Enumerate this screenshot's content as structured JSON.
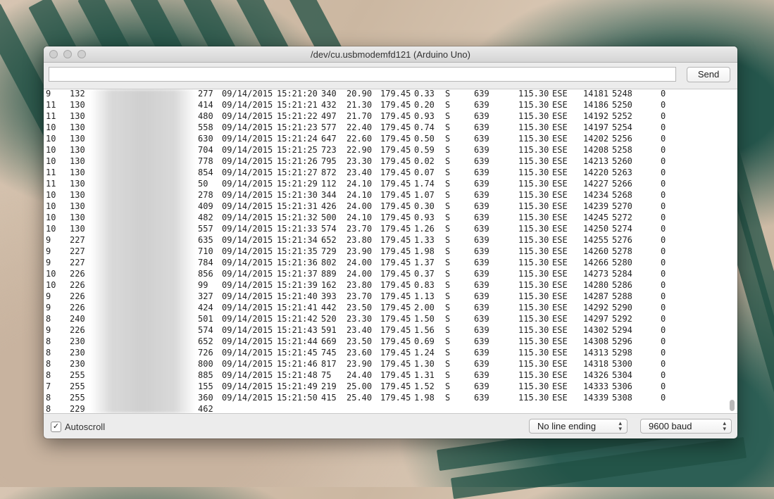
{
  "window": {
    "title": "/dev/cu.usbmodemfd121 (Arduino Uno)"
  },
  "toolbar": {
    "input_value": "",
    "send_label": "Send"
  },
  "console": {
    "lines": [
      {
        "c0": "9",
        "c1": "132",
        "c2": "277",
        "date": "09/14/2015",
        "time": "15:21:20",
        "c3": "340",
        "c4": "20.90",
        "c5": "179.45",
        "c6": "0.33",
        "c7": "S",
        "c8": "639",
        "c9": "115.30",
        "c10": "ESE",
        "c11": "14181",
        "c12": "5248",
        "c13": "0"
      },
      {
        "c0": "11",
        "c1": "130",
        "c2": "414",
        "date": "09/14/2015",
        "time": "15:21:21",
        "c3": "432",
        "c4": "21.30",
        "c5": "179.45",
        "c6": "0.20",
        "c7": "S",
        "c8": "639",
        "c9": "115.30",
        "c10": "ESE",
        "c11": "14186",
        "c12": "5250",
        "c13": "0"
      },
      {
        "c0": "11",
        "c1": "130",
        "c2": "480",
        "date": "09/14/2015",
        "time": "15:21:22",
        "c3": "497",
        "c4": "21.70",
        "c5": "179.45",
        "c6": "0.93",
        "c7": "S",
        "c8": "639",
        "c9": "115.30",
        "c10": "ESE",
        "c11": "14192",
        "c12": "5252",
        "c13": "0"
      },
      {
        "c0": "10",
        "c1": "130",
        "c2": "558",
        "date": "09/14/2015",
        "time": "15:21:23",
        "c3": "577",
        "c4": "22.40",
        "c5": "179.45",
        "c6": "0.74",
        "c7": "S",
        "c8": "639",
        "c9": "115.30",
        "c10": "ESE",
        "c11": "14197",
        "c12": "5254",
        "c13": "0"
      },
      {
        "c0": "10",
        "c1": "130",
        "c2": "630",
        "date": "09/14/2015",
        "time": "15:21:24",
        "c3": "647",
        "c4": "22.60",
        "c5": "179.45",
        "c6": "0.50",
        "c7": "S",
        "c8": "639",
        "c9": "115.30",
        "c10": "ESE",
        "c11": "14202",
        "c12": "5256",
        "c13": "0"
      },
      {
        "c0": "10",
        "c1": "130",
        "c2": "704",
        "date": "09/14/2015",
        "time": "15:21:25",
        "c3": "723",
        "c4": "22.90",
        "c5": "179.45",
        "c6": "0.59",
        "c7": "S",
        "c8": "639",
        "c9": "115.30",
        "c10": "ESE",
        "c11": "14208",
        "c12": "5258",
        "c13": "0"
      },
      {
        "c0": "10",
        "c1": "130",
        "c2": "778",
        "date": "09/14/2015",
        "time": "15:21:26",
        "c3": "795",
        "c4": "23.30",
        "c5": "179.45",
        "c6": "0.02",
        "c7": "S",
        "c8": "639",
        "c9": "115.30",
        "c10": "ESE",
        "c11": "14213",
        "c12": "5260",
        "c13": "0"
      },
      {
        "c0": "11",
        "c1": "130",
        "c2": "854",
        "date": "09/14/2015",
        "time": "15:21:27",
        "c3": "872",
        "c4": "23.40",
        "c5": "179.45",
        "c6": "0.07",
        "c7": "S",
        "c8": "639",
        "c9": "115.30",
        "c10": "ESE",
        "c11": "14220",
        "c12": "5263",
        "c13": "0"
      },
      {
        "c0": "11",
        "c1": "130",
        "c2": "50",
        "date": "09/14/2015",
        "time": "15:21:29",
        "c3": "112",
        "c4": "24.10",
        "c5": "179.45",
        "c6": "1.74",
        "c7": "S",
        "c8": "639",
        "c9": "115.30",
        "c10": "ESE",
        "c11": "14227",
        "c12": "5266",
        "c13": "0"
      },
      {
        "c0": "10",
        "c1": "130",
        "c2": "278",
        "date": "09/14/2015",
        "time": "15:21:30",
        "c3": "344",
        "c4": "24.10",
        "c5": "179.45",
        "c6": "1.07",
        "c7": "S",
        "c8": "639",
        "c9": "115.30",
        "c10": "ESE",
        "c11": "14234",
        "c12": "5268",
        "c13": "0"
      },
      {
        "c0": "10",
        "c1": "130",
        "c2": "409",
        "date": "09/14/2015",
        "time": "15:21:31",
        "c3": "426",
        "c4": "24.00",
        "c5": "179.45",
        "c6": "0.30",
        "c7": "S",
        "c8": "639",
        "c9": "115.30",
        "c10": "ESE",
        "c11": "14239",
        "c12": "5270",
        "c13": "0"
      },
      {
        "c0": "10",
        "c1": "130",
        "c2": "482",
        "date": "09/14/2015",
        "time": "15:21:32",
        "c3": "500",
        "c4": "24.10",
        "c5": "179.45",
        "c6": "0.93",
        "c7": "S",
        "c8": "639",
        "c9": "115.30",
        "c10": "ESE",
        "c11": "14245",
        "c12": "5272",
        "c13": "0"
      },
      {
        "c0": "10",
        "c1": "130",
        "c2": "557",
        "date": "09/14/2015",
        "time": "15:21:33",
        "c3": "574",
        "c4": "23.70",
        "c5": "179.45",
        "c6": "1.26",
        "c7": "S",
        "c8": "639",
        "c9": "115.30",
        "c10": "ESE",
        "c11": "14250",
        "c12": "5274",
        "c13": "0"
      },
      {
        "c0": "9",
        "c1": "227",
        "c2": "635",
        "date": "09/14/2015",
        "time": "15:21:34",
        "c3": "652",
        "c4": "23.80",
        "c5": "179.45",
        "c6": "1.33",
        "c7": "S",
        "c8": "639",
        "c9": "115.30",
        "c10": "ESE",
        "c11": "14255",
        "c12": "5276",
        "c13": "0"
      },
      {
        "c0": "9",
        "c1": "227",
        "c2": "710",
        "date": "09/14/2015",
        "time": "15:21:35",
        "c3": "729",
        "c4": "23.90",
        "c5": "179.45",
        "c6": "1.98",
        "c7": "S",
        "c8": "639",
        "c9": "115.30",
        "c10": "ESE",
        "c11": "14260",
        "c12": "5278",
        "c13": "0"
      },
      {
        "c0": "9",
        "c1": "227",
        "c2": "784",
        "date": "09/14/2015",
        "time": "15:21:36",
        "c3": "802",
        "c4": "24.00",
        "c5": "179.45",
        "c6": "1.37",
        "c7": "S",
        "c8": "639",
        "c9": "115.30",
        "c10": "ESE",
        "c11": "14266",
        "c12": "5280",
        "c13": "0"
      },
      {
        "c0": "10",
        "c1": "226",
        "c2": "856",
        "date": "09/14/2015",
        "time": "15:21:37",
        "c3": "889",
        "c4": "24.00",
        "c5": "179.45",
        "c6": "0.37",
        "c7": "S",
        "c8": "639",
        "c9": "115.30",
        "c10": "ESE",
        "c11": "14273",
        "c12": "5284",
        "c13": "0"
      },
      {
        "c0": "10",
        "c1": "226",
        "c2": "99",
        "date": "09/14/2015",
        "time": "15:21:39",
        "c3": "162",
        "c4": "23.80",
        "c5": "179.45",
        "c6": "0.83",
        "c7": "S",
        "c8": "639",
        "c9": "115.30",
        "c10": "ESE",
        "c11": "14280",
        "c12": "5286",
        "c13": "0"
      },
      {
        "c0": "9",
        "c1": "226",
        "c2": "327",
        "date": "09/14/2015",
        "time": "15:21:40",
        "c3": "393",
        "c4": "23.70",
        "c5": "179.45",
        "c6": "1.13",
        "c7": "S",
        "c8": "639",
        "c9": "115.30",
        "c10": "ESE",
        "c11": "14287",
        "c12": "5288",
        "c13": "0"
      },
      {
        "c0": "9",
        "c1": "226",
        "c2": "424",
        "date": "09/14/2015",
        "time": "15:21:41",
        "c3": "442",
        "c4": "23.50",
        "c5": "179.45",
        "c6": "2.00",
        "c7": "S",
        "c8": "639",
        "c9": "115.30",
        "c10": "ESE",
        "c11": "14292",
        "c12": "5290",
        "c13": "0"
      },
      {
        "c0": "8",
        "c1": "240",
        "c2": "501",
        "date": "09/14/2015",
        "time": "15:21:42",
        "c3": "520",
        "c4": "23.30",
        "c5": "179.45",
        "c6": "1.50",
        "c7": "S",
        "c8": "639",
        "c9": "115.30",
        "c10": "ESE",
        "c11": "14297",
        "c12": "5292",
        "c13": "0"
      },
      {
        "c0": "9",
        "c1": "226",
        "c2": "574",
        "date": "09/14/2015",
        "time": "15:21:43",
        "c3": "591",
        "c4": "23.40",
        "c5": "179.45",
        "c6": "1.56",
        "c7": "S",
        "c8": "639",
        "c9": "115.30",
        "c10": "ESE",
        "c11": "14302",
        "c12": "5294",
        "c13": "0"
      },
      {
        "c0": "8",
        "c1": "230",
        "c2": "652",
        "date": "09/14/2015",
        "time": "15:21:44",
        "c3": "669",
        "c4": "23.50",
        "c5": "179.45",
        "c6": "0.69",
        "c7": "S",
        "c8": "639",
        "c9": "115.30",
        "c10": "ESE",
        "c11": "14308",
        "c12": "5296",
        "c13": "0"
      },
      {
        "c0": "8",
        "c1": "230",
        "c2": "726",
        "date": "09/14/2015",
        "time": "15:21:45",
        "c3": "745",
        "c4": "23.60",
        "c5": "179.45",
        "c6": "1.24",
        "c7": "S",
        "c8": "639",
        "c9": "115.30",
        "c10": "ESE",
        "c11": "14313",
        "c12": "5298",
        "c13": "0"
      },
      {
        "c0": "8",
        "c1": "230",
        "c2": "800",
        "date": "09/14/2015",
        "time": "15:21:46",
        "c3": "817",
        "c4": "23.90",
        "c5": "179.45",
        "c6": "1.30",
        "c7": "S",
        "c8": "639",
        "c9": "115.30",
        "c10": "ESE",
        "c11": "14318",
        "c12": "5300",
        "c13": "0"
      },
      {
        "c0": "8",
        "c1": "255",
        "c2": "885",
        "date": "09/14/2015",
        "time": "15:21:48",
        "c3": "75",
        "c4": "24.40",
        "c5": "179.45",
        "c6": "1.31",
        "c7": "S",
        "c8": "639",
        "c9": "115.30",
        "c10": "ESE",
        "c11": "14326",
        "c12": "5304",
        "c13": "0"
      },
      {
        "c0": "7",
        "c1": "255",
        "c2": "155",
        "date": "09/14/2015",
        "time": "15:21:49",
        "c3": "219",
        "c4": "25.00",
        "c5": "179.45",
        "c6": "1.52",
        "c7": "S",
        "c8": "639",
        "c9": "115.30",
        "c10": "ESE",
        "c11": "14333",
        "c12": "5306",
        "c13": "0"
      },
      {
        "c0": "8",
        "c1": "255",
        "c2": "360",
        "date": "09/14/2015",
        "time": "15:21:50",
        "c3": "415",
        "c4": "25.40",
        "c5": "179.45",
        "c6": "1.98",
        "c7": "S",
        "c8": "639",
        "c9": "115.30",
        "c10": "ESE",
        "c11": "14339",
        "c12": "5308",
        "c13": "0"
      },
      {
        "c0": "8",
        "c1": "229",
        "c2": "462"
      }
    ]
  },
  "footer": {
    "autoscroll_label": "Autoscroll",
    "autoscroll_checked": true,
    "line_ending_selected": "No line ending",
    "baud_selected": "9600 baud"
  }
}
